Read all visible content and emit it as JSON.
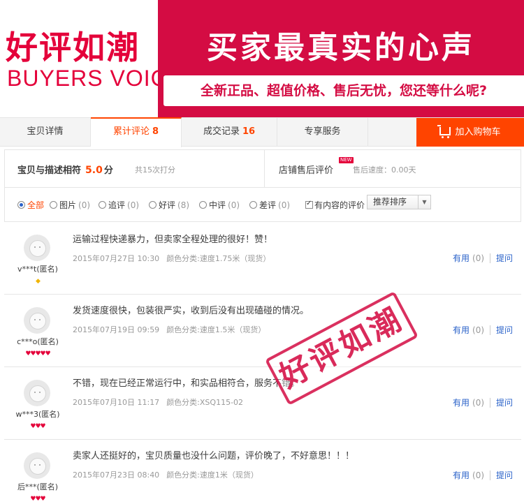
{
  "banner": {
    "brand_cn": "好评如潮",
    "brand_en": "BUYERS VOICE",
    "slogan": "买家最真实的心声",
    "subtitle": "全新正品、超值价格、售后无忧，您还等什么呢?",
    "brand_color": "#e4003a",
    "block_color": "#d40c43"
  },
  "tabs": [
    {
      "label": "宝贝详情",
      "count": ""
    },
    {
      "label": "累计评论",
      "count": "8"
    },
    {
      "label": "成交记录",
      "count": "16"
    },
    {
      "label": "专享服务",
      "count": ""
    }
  ],
  "cart_button": {
    "label": "加入购物车",
    "icon": "cart-icon",
    "color": "#ff4400"
  },
  "summary": {
    "label": "宝贝与描述相符",
    "score": "5.0",
    "unit": "分",
    "count_text": "共15次打分",
    "shop_label": "店铺售后评价",
    "new_badge": "NEW",
    "speed_text": "售后速度：0.00天"
  },
  "filters": [
    {
      "label": "全部",
      "count": ""
    },
    {
      "label": "图片",
      "count": "(0)"
    },
    {
      "label": "追评",
      "count": "(0)"
    },
    {
      "label": "好评",
      "count": "(8)"
    },
    {
      "label": "中评",
      "count": "(0)"
    },
    {
      "label": "差评",
      "count": "(0)"
    }
  ],
  "content_filter": {
    "label": "有内容的评价",
    "checked": true
  },
  "sort": {
    "selected": "推荐排序"
  },
  "reviews": [
    {
      "nick": "v***t(匿名)",
      "badge": "◆",
      "comment": "运输过程快递暴力，但卖家全程处理的很好！赞！",
      "date": "2015年07月27日 10:30",
      "sku": "颜色分类:速度1.75米（现货）",
      "useful": "有用",
      "useful_count": "(0)",
      "ask": "提问"
    },
    {
      "nick": "c***o(匿名)",
      "badge": "♥♥♥♥♥",
      "comment": "发货速度很快，包装很严实，收到后没有出现磕碰的情况。",
      "date": "2015年07月19日 09:59",
      "sku": "颜色分类:速度1.5米（现货）",
      "useful": "有用",
      "useful_count": "(0)",
      "ask": "提问"
    },
    {
      "nick": "w***3(匿名)",
      "badge": "♥♥♥",
      "comment": "不错，现在已经正常运行中，和实品相符合，服务不错。",
      "date": "2015年07月10日 11:17",
      "sku": "颜色分类:XSQ115-02",
      "useful": "有用",
      "useful_count": "(0)",
      "ask": "提问"
    },
    {
      "nick": "后***(匿名)",
      "badge": "♥♥♥",
      "comment": "卖家人还挺好的，宝贝质量也没什么问题，评价晚了，不好意思！！！",
      "date": "2015年07月23日 08:40",
      "sku": "颜色分类:速度1米（现货）",
      "useful": "有用",
      "useful_count": "(0)",
      "ask": "提问"
    }
  ],
  "stamp": {
    "text": "好评如潮"
  }
}
